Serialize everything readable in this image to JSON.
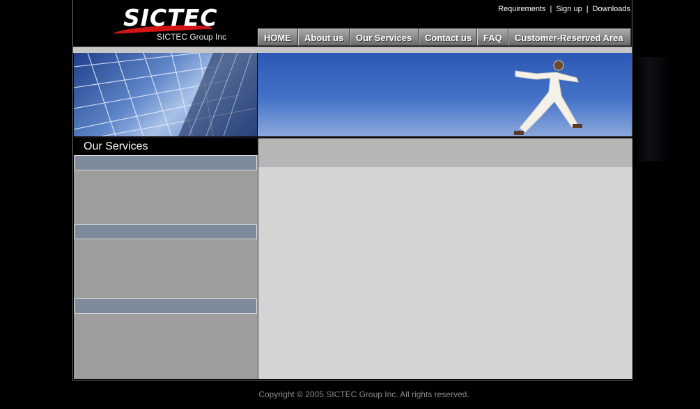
{
  "brand": {
    "logo_text": "SICTEC",
    "group_text": "SICTEC Group Inc"
  },
  "top_links": [
    "Requirements",
    "Sign up",
    "Downloads"
  ],
  "nav": [
    "HOME",
    "About us",
    "Our Services",
    "Contact us",
    "FAQ",
    "Customer-Reserved Area"
  ],
  "sidebar": {
    "title": "Our Services"
  },
  "footer": {
    "copyright": "Copyright © 2005 SICTEC Group Inc. All rights reserved."
  },
  "colors": {
    "accent_red": "#d21414",
    "sidebar_bar": "#7c8a9c",
    "content_bg": "#d3d4d3"
  },
  "icons": {
    "banner_left": "solar-panel-image",
    "banner_right": "running-man-image"
  }
}
